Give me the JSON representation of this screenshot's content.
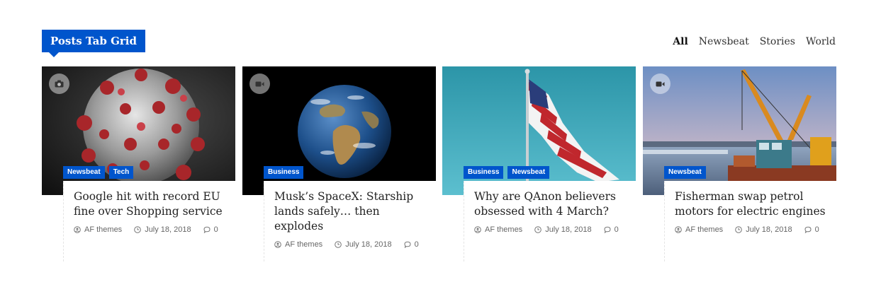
{
  "widget": {
    "title": "Posts Tab Grid"
  },
  "tabs": [
    {
      "label": "All",
      "active": true
    },
    {
      "label": "Newsbeat",
      "active": false
    },
    {
      "label": "Stories",
      "active": false
    },
    {
      "label": "World",
      "active": false
    }
  ],
  "accent_color": "#0055cc",
  "posts": [
    {
      "media_icon": "camera-icon",
      "categories": [
        "Newsbeat",
        "Tech"
      ],
      "title": "Google hit with record EU fine over Shopping service",
      "author": "AF themes",
      "date": "July 18, 2018",
      "comments": "0"
    },
    {
      "media_icon": "video-icon",
      "categories": [
        "Business"
      ],
      "title": "Musk’s SpaceX: Starship lands safely… then explodes",
      "author": "AF themes",
      "date": "July 18, 2018",
      "comments": "0"
    },
    {
      "media_icon": "",
      "categories": [
        "Business",
        "Newsbeat"
      ],
      "title": "Why are QAnon believers obsessed with 4 March?",
      "author": "AF themes",
      "date": "July 18, 2018",
      "comments": "0"
    },
    {
      "media_icon": "video-icon",
      "categories": [
        "Newsbeat"
      ],
      "title": "Fisherman swap petrol motors for electric engines",
      "author": "AF themes",
      "date": "July 18, 2018",
      "comments": "0"
    }
  ]
}
